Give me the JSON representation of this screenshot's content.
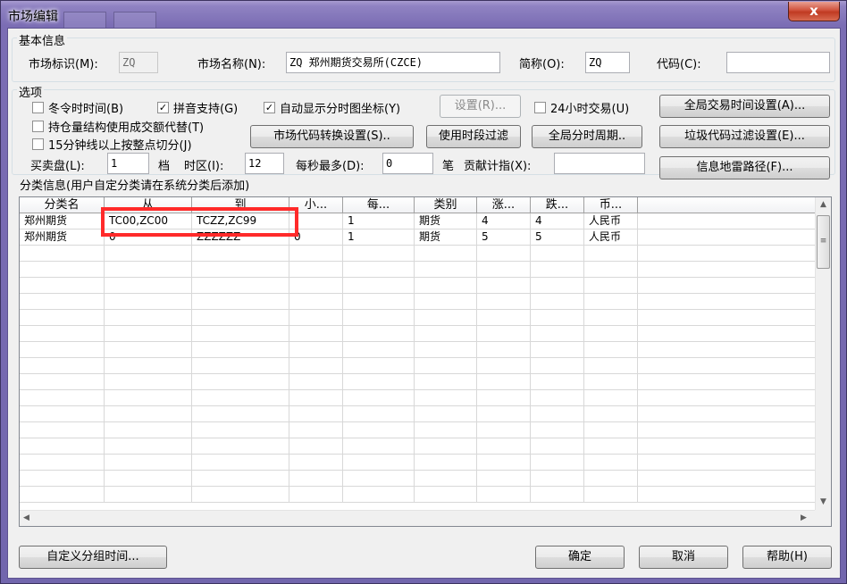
{
  "window": {
    "title": "市场编辑",
    "close_glyph": "x"
  },
  "basic_info": {
    "group_label": "基本信息",
    "market_id_label": "市场标识(M):",
    "market_id_value": "ZQ",
    "market_name_label": "市场名称(N):",
    "market_name_value": "ZQ 郑州期货交易所(CZCE)",
    "abbr_label": "简称(O):",
    "abbr_value": "ZQ",
    "code_label": "代码(C):",
    "code_value": ""
  },
  "options": {
    "group_label": "选项",
    "winter_time": {
      "label": "冬令时时间(B)",
      "checked": false
    },
    "pinyin": {
      "label": "拼音支持(G)",
      "checked": true
    },
    "auto_axis": {
      "label": "自动显示分时图坐标(Y)",
      "checked": true
    },
    "settings_button": "设置(R)...",
    "trading_24h": {
      "label": "24小时交易(U)",
      "checked": false
    },
    "global_trade_time_button": "全局交易时间设置(A)...",
    "position_structure": {
      "label": "持仓量结构使用成交额代替(T)",
      "checked": false
    },
    "split_15min": {
      "label": "15分钟线以上按整点切分(J)",
      "checked": false
    },
    "code_convert_button": "市场代码转换设置(S)..",
    "period_filter_button": "使用时段过滤",
    "global_period_button": "全局分时周期..",
    "junk_code_filter_button": "垃圾代码过滤设置(E)...",
    "buy_sell_label": "买卖盘(L):",
    "buy_sell_value": "1",
    "buy_sell_unit": "档",
    "timezone_label": "时区(I):",
    "timezone_value": "12",
    "per_second_label": "每秒最多(D):",
    "per_second_value": "0",
    "per_second_unit": "笔",
    "contribution_label": "贡献计指(X):",
    "contribution_value": "",
    "info_mine_button": "信息地雷路径(F)..."
  },
  "category": {
    "group_label": "分类信息(用户自定分类请在系统分类后添加)",
    "columns": [
      "分类名",
      "从",
      "到",
      "小...",
      "每...",
      "类别",
      "涨...",
      "跌...",
      "币..."
    ],
    "rows": [
      [
        "郑州期货",
        "TC00,ZC00",
        "TCZZ,ZC99",
        "",
        "1",
        "期货",
        "4",
        "4",
        "人民币"
      ],
      [
        "郑州期货",
        "0",
        "ZZZZZZ",
        "0",
        "1",
        "期货",
        "5",
        "5",
        "人民币"
      ]
    ]
  },
  "footer": {
    "custom_group_button": "自定义分组时间...",
    "ok_button": "确定",
    "cancel_button": "取消",
    "help_button": "帮助(H)"
  },
  "colors": {
    "highlight_box": "#ff2a2a",
    "title_bar": "#7b6db4",
    "close_button": "#c03a22"
  },
  "icons": {
    "scroll_up": "scroll-up-arrow-icon",
    "scroll_down": "scroll-down-arrow-icon",
    "scroll_left": "scroll-left-arrow-icon",
    "scroll_right": "scroll-right-arrow-icon"
  }
}
